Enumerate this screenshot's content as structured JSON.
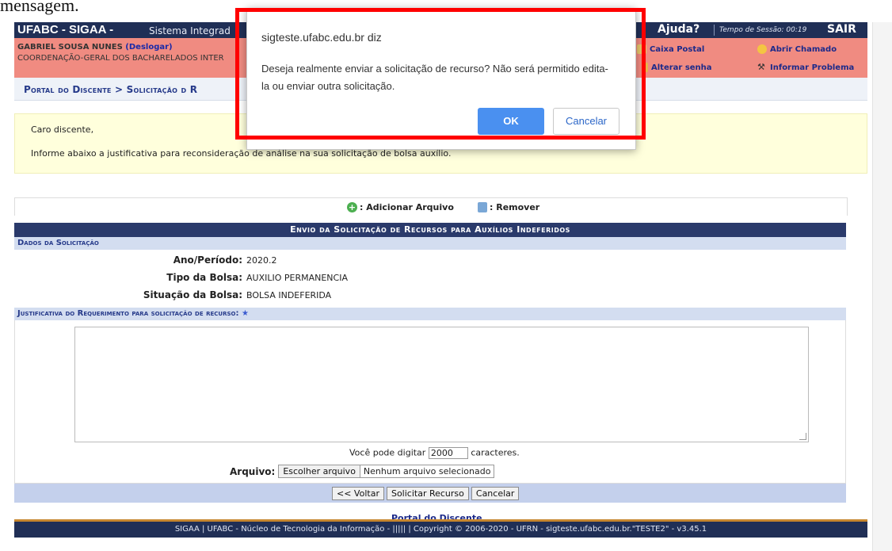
{
  "caption_fragment": "mensagem.",
  "topbar": {
    "brand": "UFABC - SIGAA -",
    "system": "Sistema Integrad",
    "help": "Ajuda?",
    "session": "Tempo de Sessão: 00:19",
    "logout": "SAIR"
  },
  "user": {
    "name": "GABRIEL SOUSA NUNES",
    "deslogar": "(Deslogar)",
    "org": "COORDENAÇÃO-GERAL DOS BACHARELADOS INTER"
  },
  "userlinks": {
    "caixa_postal": "Caixa Postal",
    "abrir_chamado": "Abrir Chamado",
    "alterar_senha": "Alterar senha",
    "informar_problema": "Informar Problema"
  },
  "breadcrumb": {
    "part1": "Portal do Discente",
    "sep": ">",
    "part2": "Solicitação d",
    "part3": "R"
  },
  "notice": {
    "greeting": "Caro discente,",
    "text": "Informe abaixo a justificativa para reconsideração de análise na sua solicitação de bolsa auxílio."
  },
  "tools": {
    "add": ": Adicionar Arquivo",
    "remove": ": Remover"
  },
  "form": {
    "title": "Envio da Solicitação de Recursos para Auxílios Indeferidos",
    "section_dados": "Dados da Solicitação",
    "fields": [
      {
        "label": "Ano/Período:",
        "value": "2020.2"
      },
      {
        "label": "Tipo da Bolsa:",
        "value": "AUXILIO PERMANENCIA"
      },
      {
        "label": "Situação da Bolsa:",
        "value": "BOLSA INDEFERIDA"
      }
    ],
    "section_justificativa": "Justificativa do Requerimento para solicitação de recurso:",
    "required_mark": "★",
    "counter_prefix": "Você pode digitar",
    "counter_value": "2000",
    "counter_suffix": "caracteres.",
    "file_label": "Arquivo:",
    "file_button": "Escolher arquivo",
    "file_status": "Nenhum arquivo selecionado",
    "btn_back": "<< Voltar",
    "btn_submit": "Solicitar Recurso",
    "btn_cancel": "Cancelar"
  },
  "portal_link": "Portal do Discente",
  "footer": "SIGAA | UFABC - Núcleo de Tecnologia da Informação - ||||| | Copyright © 2006-2020 - UFRN - sigteste.ufabc.edu.br.\"TESTE2\" - v3.45.1",
  "dialog": {
    "host": "sigteste.ufabc.edu.br diz",
    "message": "Deseja realmente enviar a solicitação de recurso? Não será permitido edita-la ou enviar outra solicitação.",
    "ok": "OK",
    "cancel": "Cancelar"
  },
  "colors": {
    "topbar": "#202f56",
    "userband": "#f08b81",
    "highlight": "#ff0000",
    "ok_button": "#4a90f0"
  }
}
